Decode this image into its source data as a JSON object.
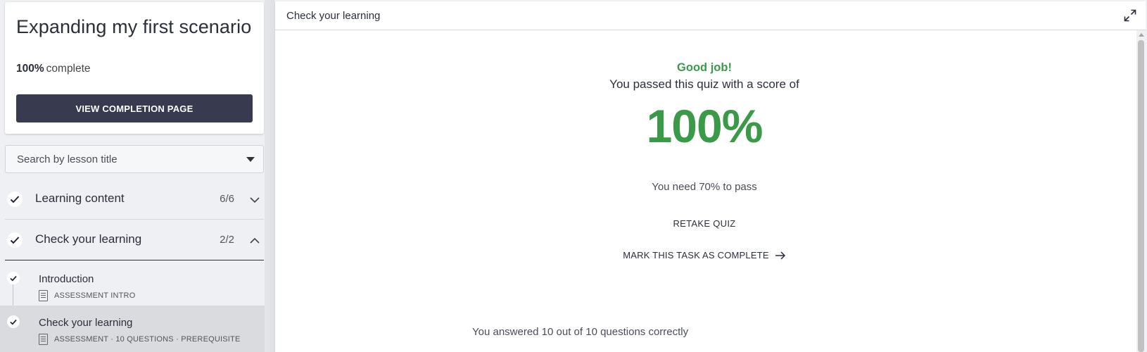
{
  "sidebar": {
    "course_title": "Expanding my first scenario",
    "progress_percent": "100%",
    "progress_suffix": "complete",
    "completion_button": "VIEW COMPLETION PAGE",
    "search_placeholder": "Search by lesson title",
    "sections": [
      {
        "title": "Learning content",
        "count": "6/6",
        "expanded": false
      },
      {
        "title": "Check your learning",
        "count": "2/2",
        "expanded": true
      }
    ],
    "lessons": [
      {
        "title": "Introduction",
        "meta": "ASSESSMENT INTRO"
      },
      {
        "title": "Check your learning",
        "meta": "ASSESSMENT · 10 QUESTIONS · PREREQUISITE"
      }
    ]
  },
  "main": {
    "topbar_title": "Check your learning",
    "good_job": "Good job!",
    "passed_text": "You passed this quiz with a score of",
    "score": "100%",
    "need_text": "You need 70% to pass",
    "retake_label": "RETAKE QUIZ",
    "mark_complete_label": "MARK THIS TASK AS COMPLETE",
    "answered_text": "You answered 10 out of 10 questions correctly"
  },
  "colors": {
    "success": "#3a9a48",
    "primary_button": "#383b4f",
    "sidebar_bg": "#eef0f3",
    "active_lesson_bg": "#d9dbdf"
  },
  "icons": [
    "check-icon",
    "chevron-down-icon",
    "chevron-up-icon",
    "caret-down-icon",
    "document-icon",
    "expand-icon",
    "arrow-right-icon"
  ]
}
